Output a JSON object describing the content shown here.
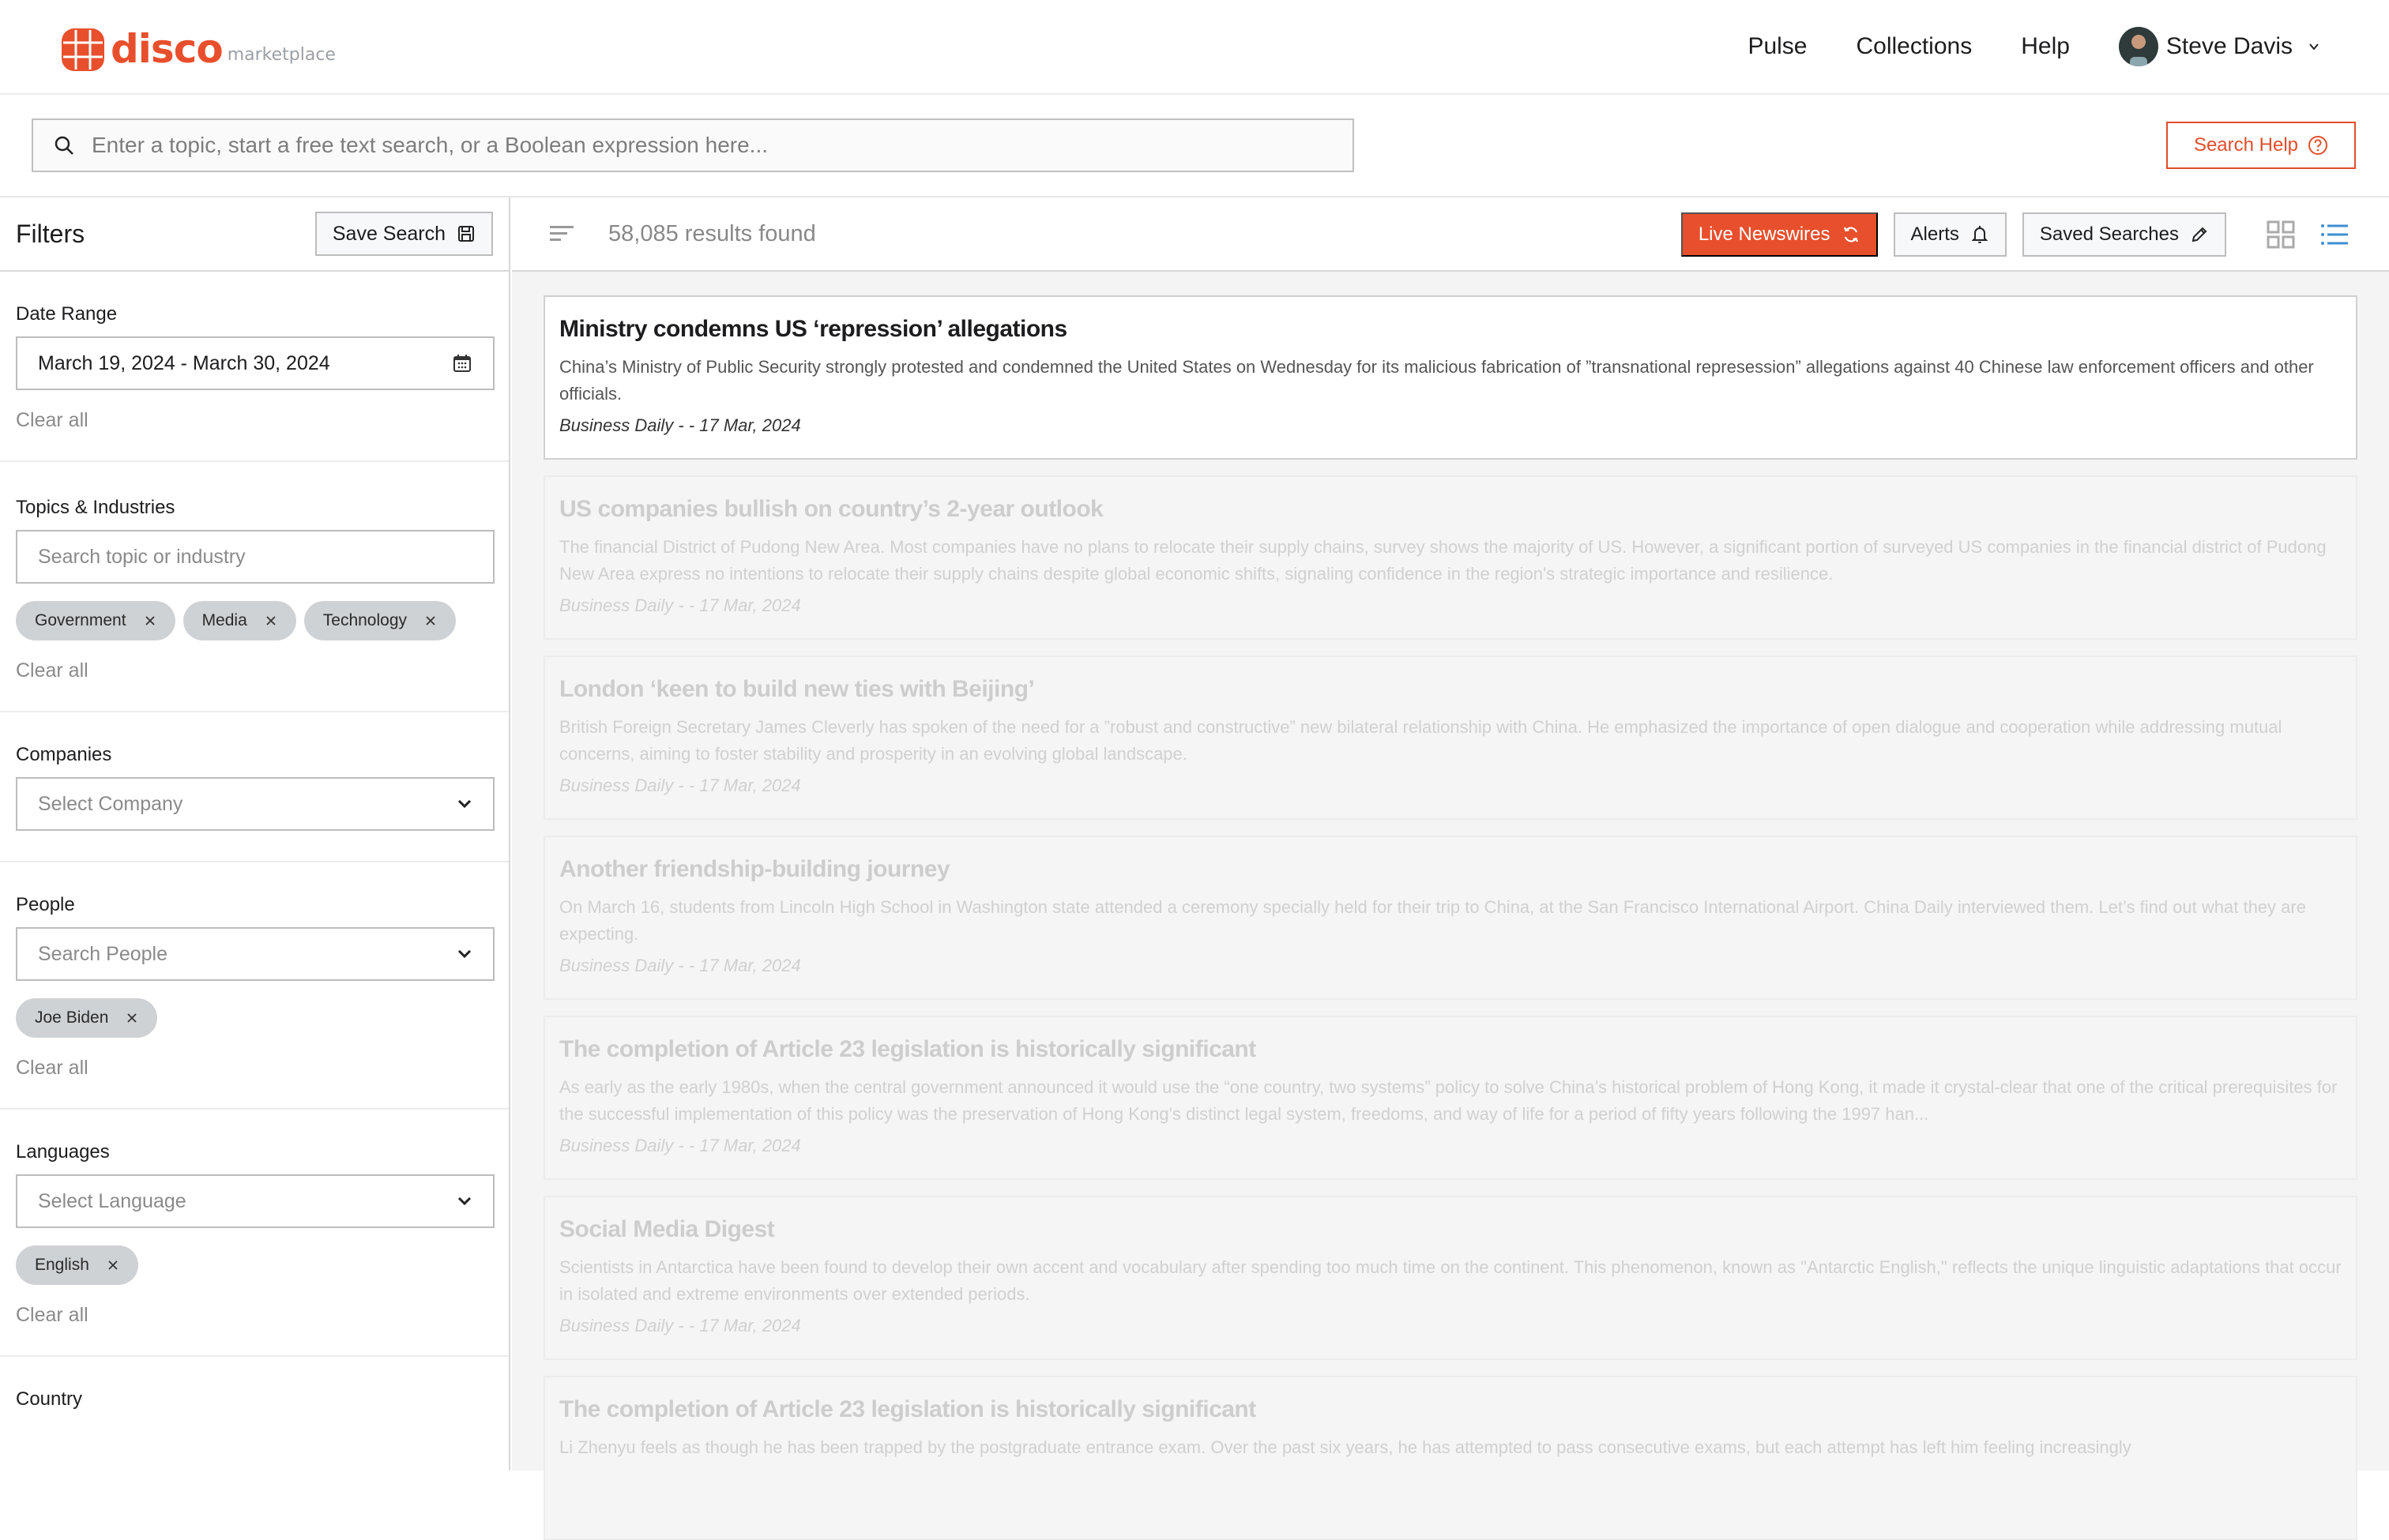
{
  "brand": {
    "name": "disco",
    "sub": "marketplace",
    "color": "#e84f2c"
  },
  "nav": {
    "links": [
      "Pulse",
      "Collections",
      "Help"
    ],
    "user_name": "Steve Davis"
  },
  "search": {
    "placeholder": "Enter a topic, start a free text search, or a Boolean expression here...",
    "value": "",
    "help_label": "Search Help"
  },
  "sidebar": {
    "title": "Filters",
    "save_search_label": "Save Search",
    "clear_all_label": "Clear all",
    "date_range": {
      "label": "Date Range",
      "value": "March 19, 2024 - March 30, 2024"
    },
    "topics": {
      "label": "Topics & Industries",
      "placeholder": "Search topic or industry",
      "chips": [
        "Government",
        "Media",
        "Technology"
      ]
    },
    "companies": {
      "label": "Companies",
      "placeholder": "Select Company"
    },
    "people": {
      "label": "People",
      "placeholder": "Search People",
      "chips": [
        "Joe Biden"
      ]
    },
    "languages": {
      "label": "Languages",
      "placeholder": "Select Language",
      "chips": [
        "English"
      ]
    },
    "country": {
      "label": "Country"
    }
  },
  "toolbar": {
    "results_text": "58,085 results found",
    "live_newswires_label": "Live Newswires",
    "alerts_label": "Alerts",
    "saved_searches_label": "Saved Searches",
    "active_view": "list"
  },
  "articles": [
    {
      "title": "Ministry condemns US ‘repression’ allegations",
      "summary": "China’s Ministry of Public Security strongly protested and condemned the United States on Wednesday for its malicious fabrication of ”transnational represession” allegations against 40 Chinese law enforcement officers and other officials.",
      "meta": "Business Daily - - 17 Mar, 2024",
      "active": true
    },
    {
      "title": "US companies bullish on country’s 2-year outlook",
      "summary": "The financial District of Pudong New Area. Most companies have no plans to relocate their supply chains, survey shows the majority of US. However, a significant portion of surveyed US companies in the financial district of Pudong New Area express no intentions to relocate their supply chains despite global economic shifts, signaling confidence in the region's strategic importance and resilience.",
      "meta": "Business Daily - - 17 Mar, 2024",
      "active": false
    },
    {
      "title": "London ‘keen to build new ties with Beijing’",
      "summary": "British Foreign Secretary James Cleverly has spoken of the need for a ”robust and constructive” new bilateral relationship with China. He emphasized the importance of open dialogue and cooperation while addressing mutual concerns, aiming to foster stability and prosperity in an evolving global landscape.",
      "meta": "Business Daily - - 17 Mar, 2024",
      "active": false
    },
    {
      "title": "Another friendship-building journey",
      "summary": "On March 16, students from Lincoln High School in Washington state attended a ceremony specially held for their trip to China, at the San Francisco International Airport. China Daily interviewed them. Let’s find out what they are expecting.",
      "meta": "Business Daily - - 17 Mar, 2024",
      "active": false
    },
    {
      "title": "The completion of Article 23 legislation is historically significant",
      "summary": "As early as the early 1980s, when the central government announced it would use the “one country, two systems” policy to solve China’s historical problem of Hong Kong, it made it crystal-clear that one of the critical prerequisites for the successful implementation of this policy was the preservation of Hong Kong's distinct legal system, freedoms, and way of life for a period of fifty years following the 1997 han...",
      "meta": "Business Daily - - 17 Mar, 2024",
      "active": false
    },
    {
      "title": "Social Media Digest",
      "summary": "Scientists in Antarctica have been found to develop their own accent and vocabulary after spending too much time on the continent. This phenomenon, known as \"Antarctic English,\" reflects the unique linguistic adaptations that occur in isolated and extreme environments over extended periods.",
      "meta": "Business Daily - - 17 Mar, 2024",
      "active": false
    },
    {
      "title": "The completion of Article 23 legislation is historically significant",
      "summary": "Li Zhenyu feels as though he has been trapped by the postgraduate entrance exam. Over the past six years, he has attempted to pass consecutive exams, but each attempt has left him feeling increasingly",
      "meta": "",
      "active": false
    }
  ]
}
